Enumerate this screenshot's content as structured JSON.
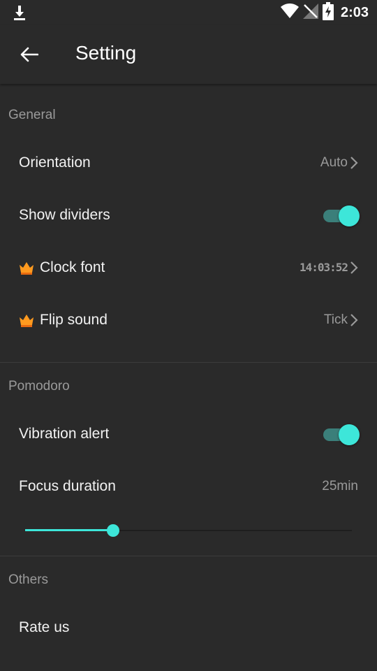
{
  "status_bar": {
    "time": "2:03",
    "icons": [
      "download-icon",
      "wifi-icon",
      "no-signal-icon",
      "battery-charging-icon"
    ]
  },
  "app_bar": {
    "title": "Setting",
    "back_icon": "arrow-back-icon"
  },
  "sections": {
    "general": {
      "header": "General",
      "orientation": {
        "label": "Orientation",
        "value": "Auto"
      },
      "show_dividers": {
        "label": "Show dividers",
        "enabled": true
      },
      "clock_font": {
        "label": "Clock font",
        "value": "14:03:52",
        "badge_icon": "crown-icon"
      },
      "flip_sound": {
        "label": "Flip sound",
        "value": "Tick",
        "badge_icon": "crown-icon"
      }
    },
    "pomodoro": {
      "header": "Pomodoro",
      "vibration_alert": {
        "label": "Vibration alert",
        "enabled": true
      },
      "focus_duration": {
        "label": "Focus duration",
        "value": "25min",
        "slider_fraction": 0.27
      }
    },
    "others": {
      "header": "Others",
      "rate_us": {
        "label": "Rate us"
      }
    }
  },
  "colors": {
    "background": "#2a2a2a",
    "accent": "#3de6d9",
    "accent_track": "#3b7f7a",
    "secondary_text": "#9a9a9a",
    "crown": "#ff9a1f"
  }
}
